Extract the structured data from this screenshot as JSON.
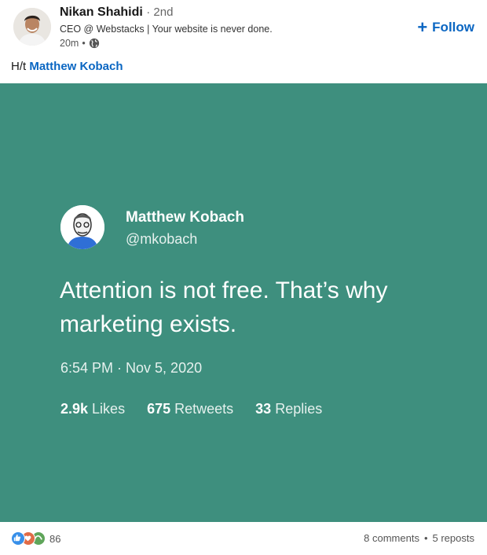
{
  "author": {
    "name": "Nikan Shahidi",
    "degree": "2nd",
    "headline": "CEO @ Webstacks | Your website is never done.",
    "time": "20m",
    "visibility_icon": "globe-icon"
  },
  "follow_button": {
    "plus": "+",
    "label": "Follow"
  },
  "post": {
    "prefix": "H/t",
    "mention": "Matthew Kobach"
  },
  "tweet_card": {
    "background": "#3e8f7e",
    "name": "Matthew Kobach",
    "handle": "@mkobach",
    "text": "Attention is not free. That’s why marketing exists.",
    "date": "6:54 PM · Nov 5, 2020",
    "stats": {
      "likes_count": "2.9k",
      "likes_label": "Likes",
      "retweets_count": "675",
      "retweets_label": "Retweets",
      "replies_count": "33",
      "replies_label": "Replies"
    }
  },
  "social": {
    "reaction_icons": [
      "like-icon",
      "celebrate-icon",
      "support-icon"
    ],
    "reaction_count": "86",
    "comments": "8 comments",
    "separator": "•",
    "reposts": "5 reposts"
  },
  "colors": {
    "accent": "#0a66c2"
  }
}
